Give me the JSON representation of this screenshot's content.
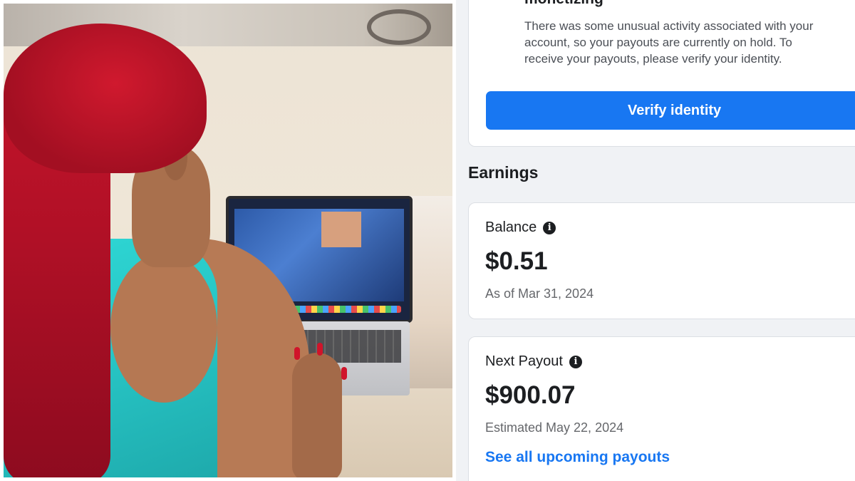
{
  "alert": {
    "title": "monetizing",
    "body": "There was some unusual activity associated with your account, so your payouts are currently on hold. To receive your payouts, please verify your identity.",
    "button_label": "Verify identity"
  },
  "earnings": {
    "heading": "Earnings",
    "balance": {
      "label": "Balance",
      "amount": "$0.51",
      "as_of": "As of Mar 31, 2024"
    },
    "next_payout": {
      "label": "Next Payout",
      "amount": "$900.07",
      "estimated": "Estimated May 22, 2024",
      "link_label": "See all upcoming payouts"
    }
  },
  "icons": {
    "info": "info-icon",
    "info_glyph": "i"
  },
  "colors": {
    "accent": "#1877f2",
    "background": "#f0f2f5",
    "text_primary": "#1c1e21",
    "text_secondary": "#65676b"
  }
}
